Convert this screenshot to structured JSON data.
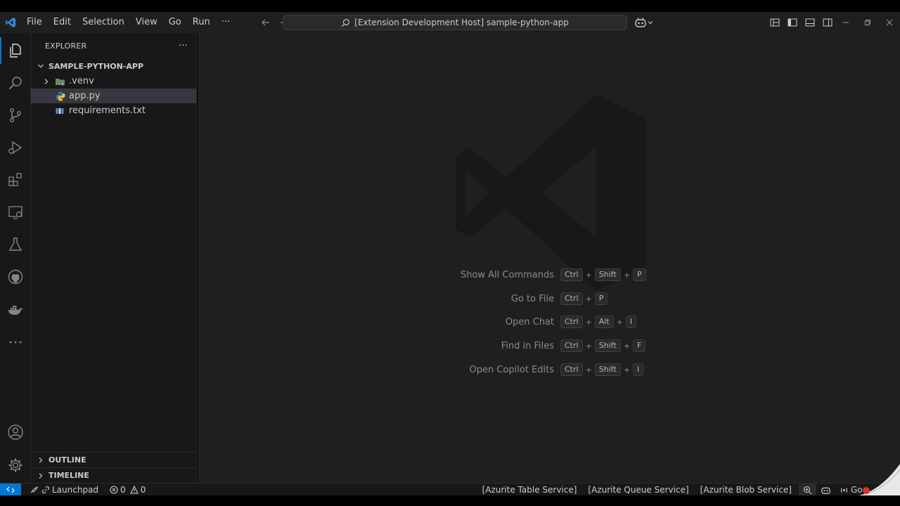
{
  "titlebar": {
    "menu": [
      "File",
      "Edit",
      "Selection",
      "View",
      "Go",
      "Run"
    ],
    "more": "···",
    "command_center": "[Extension Development Host] sample-python-app"
  },
  "sidebar": {
    "title": "EXPLORER",
    "more": "···",
    "folder": "SAMPLE-PYTHON-APP",
    "items": [
      {
        "label": ".venv",
        "kind": "folder"
      },
      {
        "label": "app.py",
        "kind": "python"
      },
      {
        "label": "requirements.txt",
        "kind": "text"
      }
    ],
    "outline": "OUTLINE",
    "timeline": "TIMELINE"
  },
  "editor": {
    "shortcuts": [
      {
        "label": "Show All Commands",
        "keys": [
          "Ctrl",
          "Shift",
          "P"
        ]
      },
      {
        "label": "Go to File",
        "keys": [
          "Ctrl",
          "P"
        ]
      },
      {
        "label": "Open Chat",
        "keys": [
          "Ctrl",
          "Alt",
          "I"
        ]
      },
      {
        "label": "Find in Files",
        "keys": [
          "Ctrl",
          "Shift",
          "F"
        ]
      },
      {
        "label": "Open Copilot Edits",
        "keys": [
          "Ctrl",
          "Shift",
          "I"
        ]
      }
    ]
  },
  "statusbar": {
    "launchpad": "Launchpad",
    "errors": "0",
    "warnings": "0",
    "azurite_table": "[Azurite Table Service]",
    "azurite_queue": "[Azurite Queue Service]",
    "azurite_blob": "[Azurite Blob Service]",
    "go_live": "Go"
  },
  "colors": {
    "accent": "#0078d4",
    "editor_bg": "#1f1f1f",
    "sidebar_bg": "#181818",
    "selection": "#37373d"
  }
}
